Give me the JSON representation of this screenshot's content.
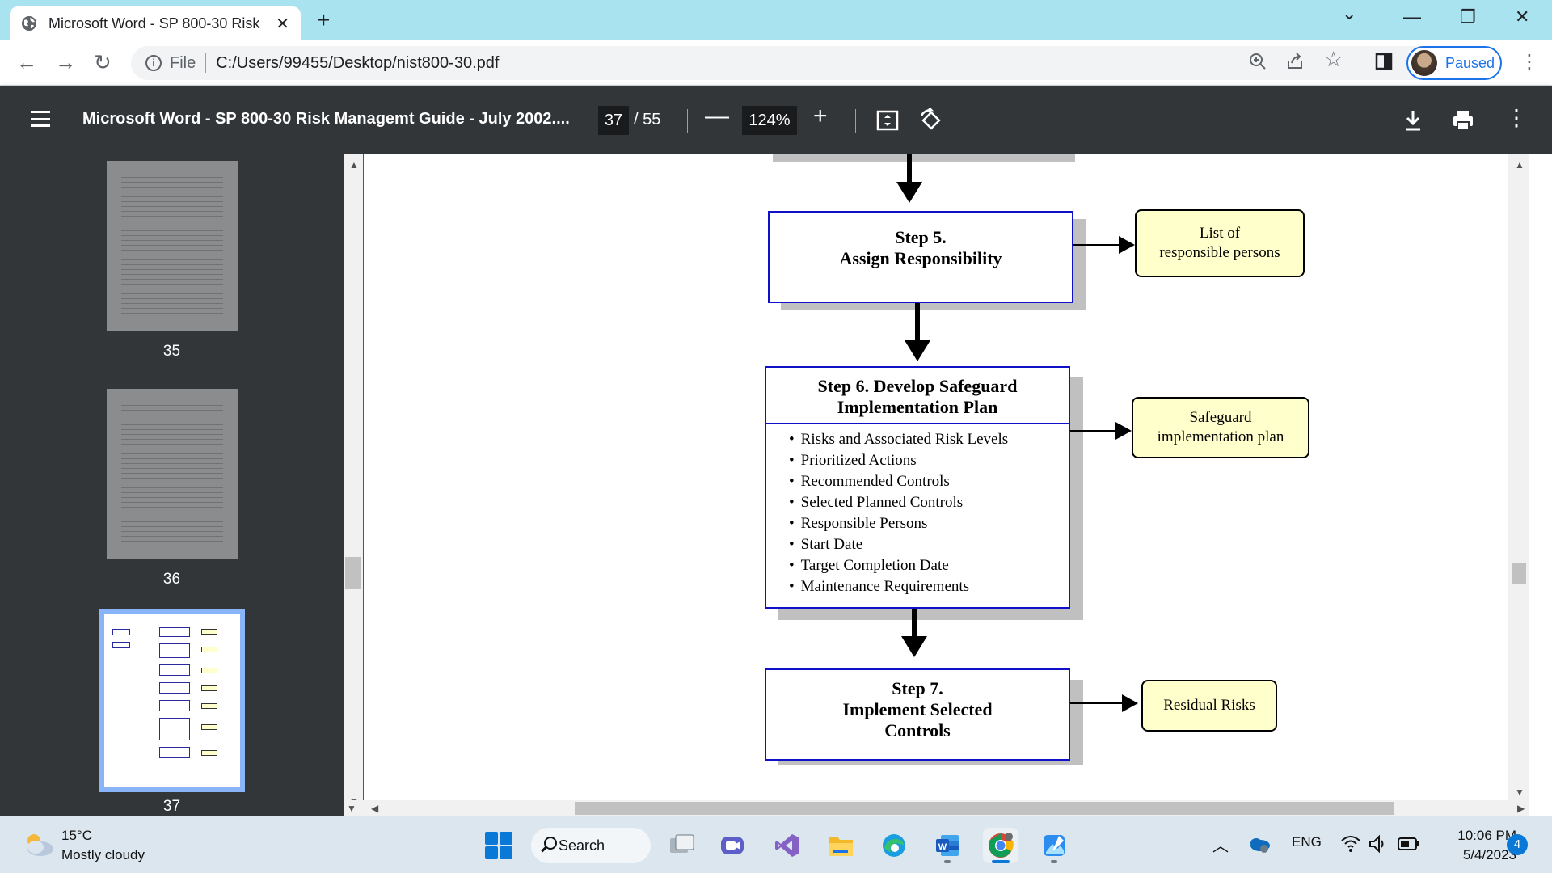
{
  "browser": {
    "tab_title": "Microsoft Word - SP 800-30 Risk",
    "tab_close": "✕",
    "new_tab": "+",
    "window_controls": {
      "chevron": "⌄",
      "minimize": "—",
      "restore": "❐",
      "close": "✕"
    },
    "nav": {
      "back": "←",
      "forward": "→",
      "reload": "↻"
    },
    "address": {
      "scheme": "File",
      "url": "C:/Users/99455/Desktop/nist800-30.pdf"
    },
    "profile_status": "Paused",
    "menu": "⋮"
  },
  "pdf_toolbar": {
    "title": "Microsoft Word - SP 800-30 Risk Managemt Guide - July 2002....",
    "current_page": "37",
    "total_pages": "/ 55",
    "zoom": "124%",
    "zoom_out": "—",
    "zoom_in": "+"
  },
  "thumbnails": [
    {
      "page": "35"
    },
    {
      "page": "36"
    },
    {
      "page": "37",
      "selected": true
    }
  ],
  "flowchart": {
    "step5": {
      "title_line1": "Step 5.",
      "title_line2": "Assign Responsibility",
      "output_line1": "List of",
      "output_line2": "responsible persons"
    },
    "step6": {
      "title_line1": "Step 6.  Develop Safeguard",
      "title_line2": "Implementation Plan",
      "items": [
        "Risks and Associated Risk Levels",
        "Prioritized Actions",
        "Recommended Controls",
        "Selected Planned Controls",
        "Responsible Persons",
        "Start Date",
        "Target Completion Date",
        "Maintenance Requirements"
      ],
      "output_line1": "Safeguard",
      "output_line2": "implementation plan"
    },
    "step7": {
      "title_line1": "Step 7.",
      "title_line2": "Implement Selected",
      "title_line3": "Controls",
      "output": "Residual Risks"
    }
  },
  "taskbar": {
    "weather_temp": "15°C",
    "weather_desc": "Mostly cloudy",
    "search": "Search",
    "language": "ENG",
    "time": "10:06 PM",
    "date": "5/4/2023",
    "notifications": "4"
  },
  "colors": {
    "tabstrip": "#a9e3ef",
    "pdf_toolbar": "#323639",
    "flow_border": "#1010c8",
    "output_fill": "#ffffcc",
    "accent": "#1a73e8"
  }
}
